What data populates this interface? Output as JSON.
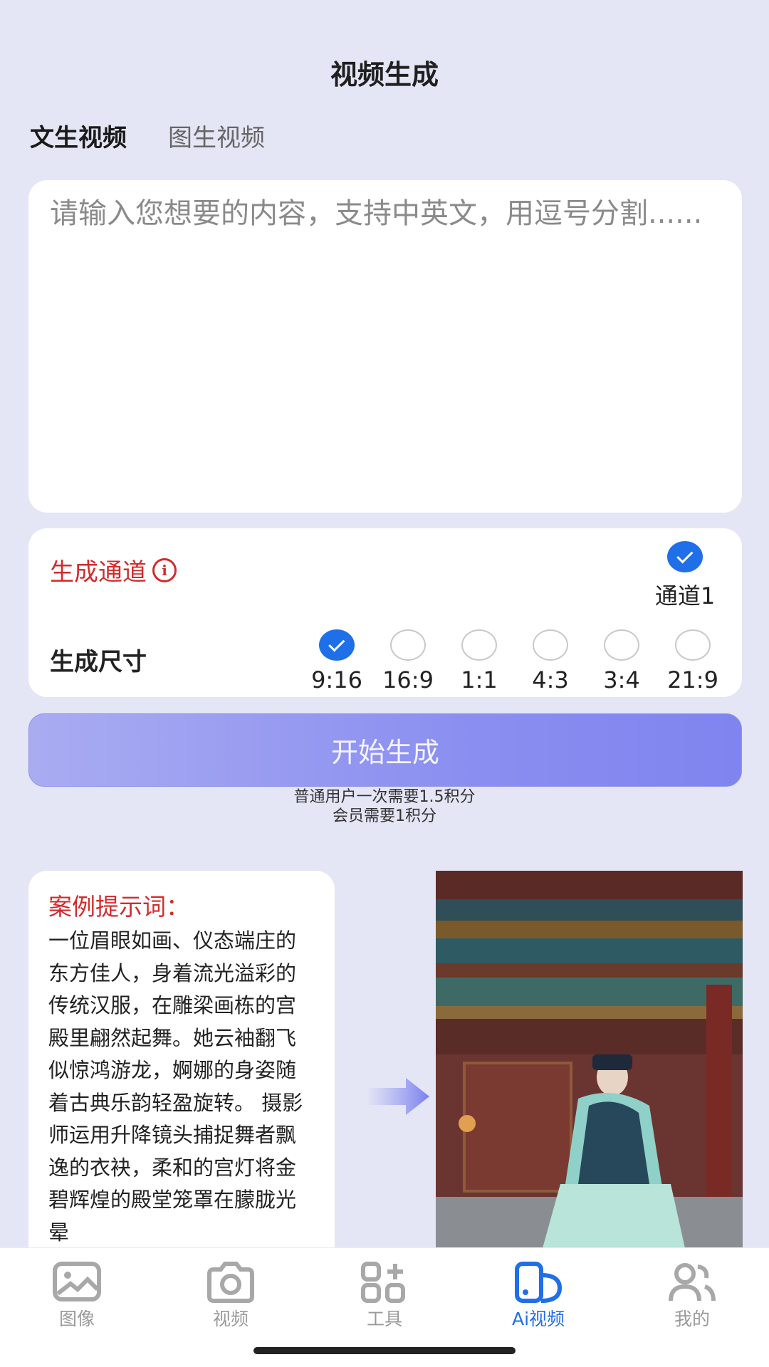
{
  "header": {
    "title": "视频生成"
  },
  "tabs": [
    {
      "label": "文生视频",
      "active": true
    },
    {
      "label": "图生视频",
      "active": false
    }
  ],
  "prompt": {
    "placeholder": "请输入您想要的内容，支持中英文，用逗号分割......",
    "value": ""
  },
  "options": {
    "channel_label": "生成通道",
    "channel": {
      "label": "通道1",
      "selected": true
    },
    "size_label": "生成尺寸",
    "sizes": [
      {
        "label": "9:16",
        "selected": true
      },
      {
        "label": "16:9",
        "selected": false
      },
      {
        "label": "1:1",
        "selected": false
      },
      {
        "label": "4:3",
        "selected": false
      },
      {
        "label": "3:4",
        "selected": false
      },
      {
        "label": "21:9",
        "selected": false
      }
    ]
  },
  "generate": {
    "button_label": "开始生成",
    "cost_line1": "普通用户一次需要1.5积分",
    "cost_line2": "会员需要1积分"
  },
  "example": {
    "title": "案例提示词：",
    "text": "一位眉眼如画、仪态端庄的东方佳人，身着流光溢彩的传统汉服，在雕梁画栋的宫殿里翩然起舞。她云袖翻飞似惊鸿游龙，婀娜的身姿随着古典乐韵轻盈旋转。 摄影师运用升降镜头捕捉舞者飘逸的衣袂，柔和的宫灯将金碧辉煌的殿堂笼罩在朦胧光晕"
  },
  "colors": {
    "background": "#e4e5f5",
    "accent_red": "#d12c2c",
    "accent_blue": "#1f6fe8",
    "button_purple": "#8b8ff0"
  },
  "nav": [
    {
      "label": "图像",
      "icon": "image-icon",
      "active": false
    },
    {
      "label": "视频",
      "icon": "camera-icon",
      "active": false
    },
    {
      "label": "工具",
      "icon": "tools-grid-icon",
      "active": false
    },
    {
      "label": "Ai视频",
      "icon": "ai-video-icon",
      "active": true
    },
    {
      "label": "我的",
      "icon": "profile-icon",
      "active": false
    }
  ]
}
